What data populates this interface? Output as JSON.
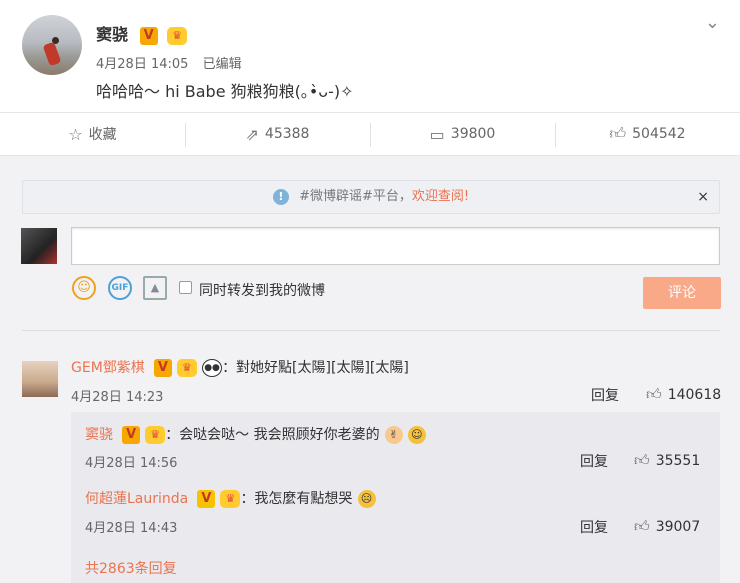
{
  "post": {
    "author": "窦骁",
    "date": "4月28日 14:05",
    "edited": "已编辑",
    "text": "哈哈哈～ hi Babe 狗粮狗粮(｡•̀ᴗ-)✧"
  },
  "actions": {
    "favorite": "收藏",
    "forward": "45388",
    "comment": "39800",
    "like": "504542"
  },
  "notice": {
    "prefix": "#微博辟谣#平台，",
    "link": "欢迎查阅!"
  },
  "composer": {
    "repost_label": "同时转发到我的微博",
    "submit": "评论"
  },
  "comments": [
    {
      "name": "GEM鄧紫棋",
      "text": "：對她好點[太陽][太陽][太陽]",
      "time": "4月28日 14:23",
      "reply": "回复",
      "likes": "140618"
    }
  ],
  "replies": [
    {
      "name": "窦骁",
      "text": "：会哒会哒～ 我会照顾好你老婆的",
      "time": "4月28日 14:56",
      "reply": "回复",
      "likes": "35551"
    },
    {
      "name": "何超蓮Laurinda",
      "text": "：我怎麼有點想哭",
      "time": "4月28日 14:43",
      "reply": "回复",
      "likes": "39007"
    }
  ],
  "more_replies": "共2863条回复",
  "icons": {
    "verified": "V",
    "crown": "crown-icon",
    "close": "×"
  }
}
